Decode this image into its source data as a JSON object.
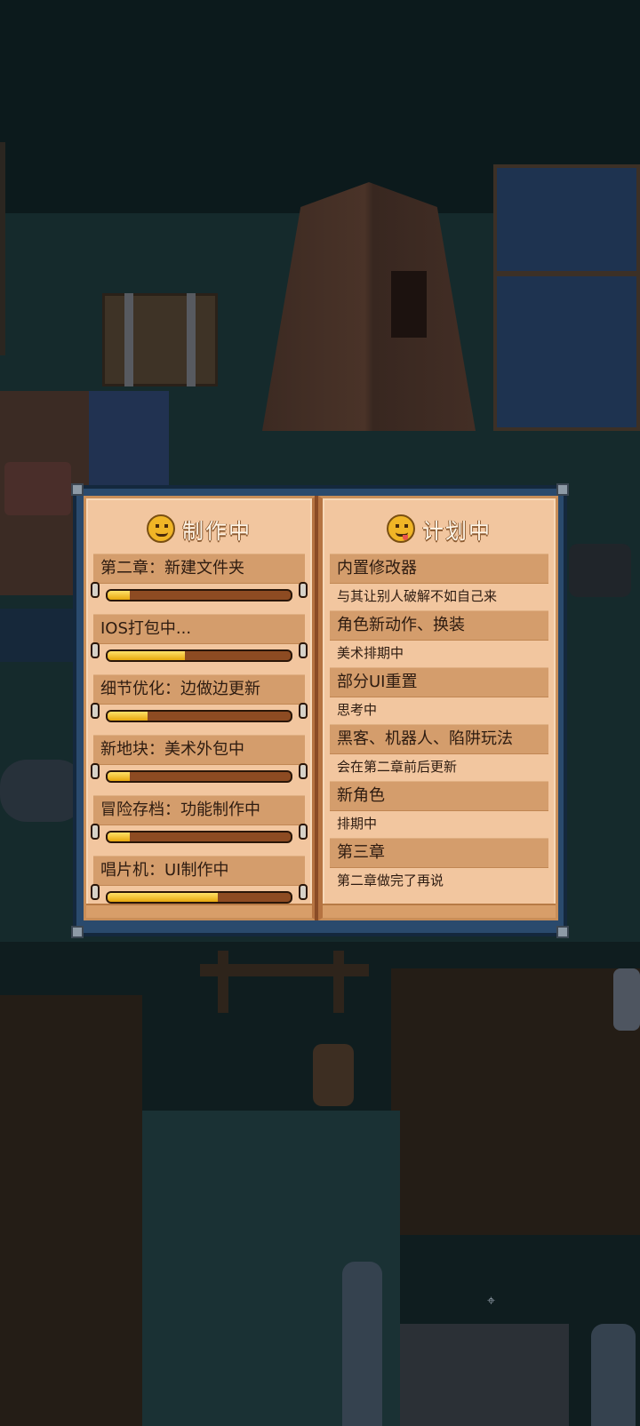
{
  "panel": {
    "left_page": {
      "title": "制作中",
      "icon": "smile-emoji-icon",
      "tasks": [
        {
          "label": "第二章：新建文件夹",
          "progress": 0.12
        },
        {
          "label": "IOS打包中...",
          "progress": 0.42
        },
        {
          "label": "细节优化：边做边更新",
          "progress": 0.22
        },
        {
          "label": "新地块：美术外包中",
          "progress": 0.12
        },
        {
          "label": "冒险存档：功能制作中",
          "progress": 0.12
        },
        {
          "label": "唱片机：UI制作中",
          "progress": 0.6
        }
      ]
    },
    "right_page": {
      "title": "计划中",
      "icon": "tongue-emoji-icon",
      "plans": [
        {
          "title": "内置修改器",
          "note": "与其让别人破解不如自己来"
        },
        {
          "title": "角色新动作、换装",
          "note": "美术排期中"
        },
        {
          "title": "部分UI重置",
          "note": "思考中"
        },
        {
          "title": "黑客、机器人、陷阱玩法",
          "note": "会在第二章前后更新"
        },
        {
          "title": "新角色",
          "note": "排期中"
        },
        {
          "title": "第三章",
          "note": "第二章做完了再说"
        }
      ]
    }
  },
  "colors": {
    "page": "#f2c69f",
    "band": "#d49d6c",
    "bar_fill": "#f2c230",
    "bar_track": "#8d4b22",
    "book_frame": "#2a4a6d"
  }
}
